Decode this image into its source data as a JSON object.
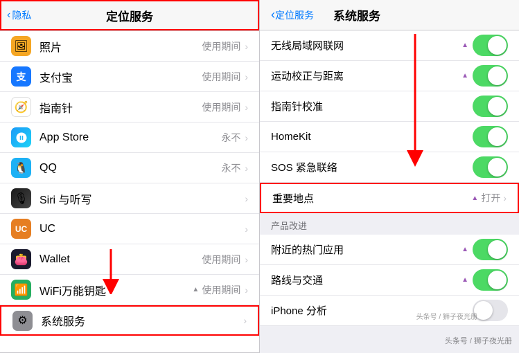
{
  "left": {
    "header": {
      "back_label": "隐私",
      "title": "定位服务"
    },
    "items": [
      {
        "id": "photos",
        "icon_bg": "#f5a623",
        "icon": "🖼",
        "label": "照片",
        "value": "使用期间",
        "has_chevron": true
      },
      {
        "id": "alipay",
        "icon_bg": "#1677ff",
        "icon": "支",
        "label": "支付宝",
        "value": "使用期间",
        "has_chevron": true
      },
      {
        "id": "compass",
        "icon_bg": "#fff",
        "icon": "🧭",
        "label": "指南针",
        "value": "使用期间",
        "has_chevron": true
      },
      {
        "id": "appstore",
        "icon_bg": "#1b9af7",
        "icon": "A",
        "label": "App Store",
        "value": "永不",
        "has_chevron": true
      },
      {
        "id": "qq",
        "icon_bg": "#1db1f5",
        "icon": "🐧",
        "label": "QQ",
        "value": "永不",
        "has_chevron": true
      },
      {
        "id": "siri",
        "icon_bg": "#000",
        "icon": "🎙",
        "label": "Siri 与听写",
        "value": "",
        "has_chevron": true
      },
      {
        "id": "uc",
        "icon_bg": "#e67e22",
        "icon": "UC",
        "label": "UC",
        "value": "",
        "has_chevron": true
      },
      {
        "id": "wallet",
        "icon_bg": "#000",
        "icon": "👛",
        "label": "Wallet",
        "value": "使用期间",
        "has_chevron": true
      },
      {
        "id": "wifi",
        "icon_bg": "#2ecc71",
        "icon": "📶",
        "label": "WiFi万能钥匙",
        "value": "使用期间",
        "has_chevron": true,
        "location_icon": true
      },
      {
        "id": "system",
        "icon_bg": "#8e8e93",
        "icon": "⚙",
        "label": "系统服务",
        "value": "",
        "has_chevron": true,
        "red_border": true
      }
    ]
  },
  "right": {
    "header": {
      "back_label": "定位服务",
      "title": "系统服务"
    },
    "items": [
      {
        "id": "wifi_net",
        "label": "无线局域网联网",
        "toggle": true,
        "location": "purple"
      },
      {
        "id": "motion",
        "label": "运动校正与距离",
        "toggle": true,
        "location": "purple"
      },
      {
        "id": "compass_cal",
        "label": "指南针校准",
        "toggle": true,
        "location": "none"
      },
      {
        "id": "homekit",
        "label": "HomeKit",
        "toggle": true,
        "location": "none"
      },
      {
        "id": "sos",
        "label": "SOS 紧急联络",
        "toggle": true,
        "location": "none"
      },
      {
        "id": "important",
        "label": "重要地点",
        "toggle": false,
        "value": "打开",
        "location": "purple",
        "red_border": true
      },
      {
        "id": "section_product",
        "is_section": true,
        "label": "产品改进"
      },
      {
        "id": "nearby_hot",
        "label": "附近的热门应用",
        "toggle": true,
        "location": "purple"
      },
      {
        "id": "routes",
        "label": "路线与交通",
        "toggle": true,
        "location": "purple"
      },
      {
        "id": "iphone_analytics",
        "label": "iPhone 分析",
        "toggle": false,
        "location": "none",
        "no_toggle": true
      }
    ],
    "watermark": "头条号 / 狮子夜光册"
  }
}
